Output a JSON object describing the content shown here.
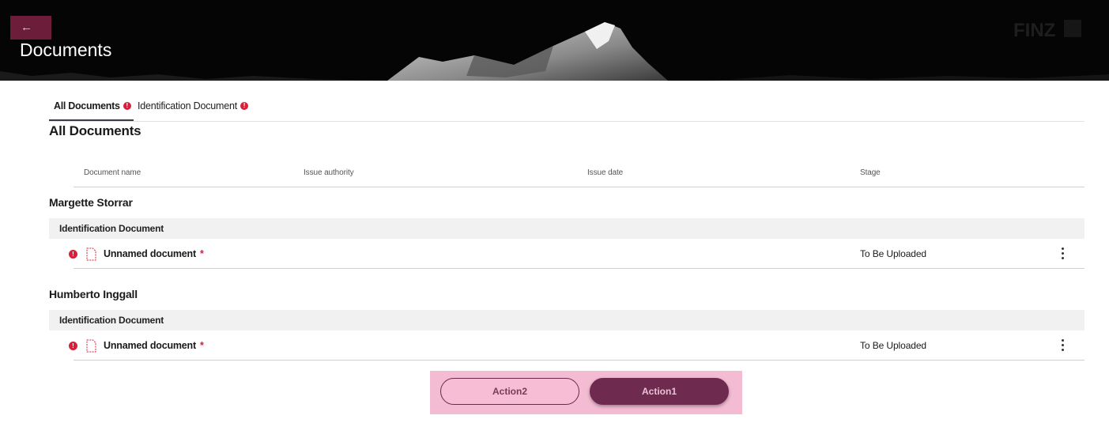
{
  "header": {
    "title": "Documents",
    "back_icon": "←",
    "logo_text": "FINZ"
  },
  "tabs": [
    {
      "label": "All Documents",
      "active": true,
      "alert": "!"
    },
    {
      "label": "Identification Document",
      "active": false,
      "alert": "!"
    }
  ],
  "section_title": "All Documents",
  "columns": [
    "Document name",
    "Issue authority",
    "Issue date",
    "Stage"
  ],
  "groups": [
    {
      "person": "Margette Storrar",
      "category": "Identification Document",
      "doc": {
        "name": "Unnamed document",
        "required_mark": "*",
        "stage": "To Be Uploaded",
        "alert": "!"
      }
    },
    {
      "person": "Humberto Inggall",
      "category": "Identification Document",
      "doc": {
        "name": "Unnamed document",
        "required_mark": "*",
        "stage": "To Be Uploaded",
        "alert": "!"
      }
    }
  ],
  "actions": {
    "secondary": "Action2",
    "primary": "Action1"
  },
  "colors": {
    "brand": "#6e2a4f",
    "alert": "#d6203b",
    "action_bar": "#f4bcd3"
  }
}
